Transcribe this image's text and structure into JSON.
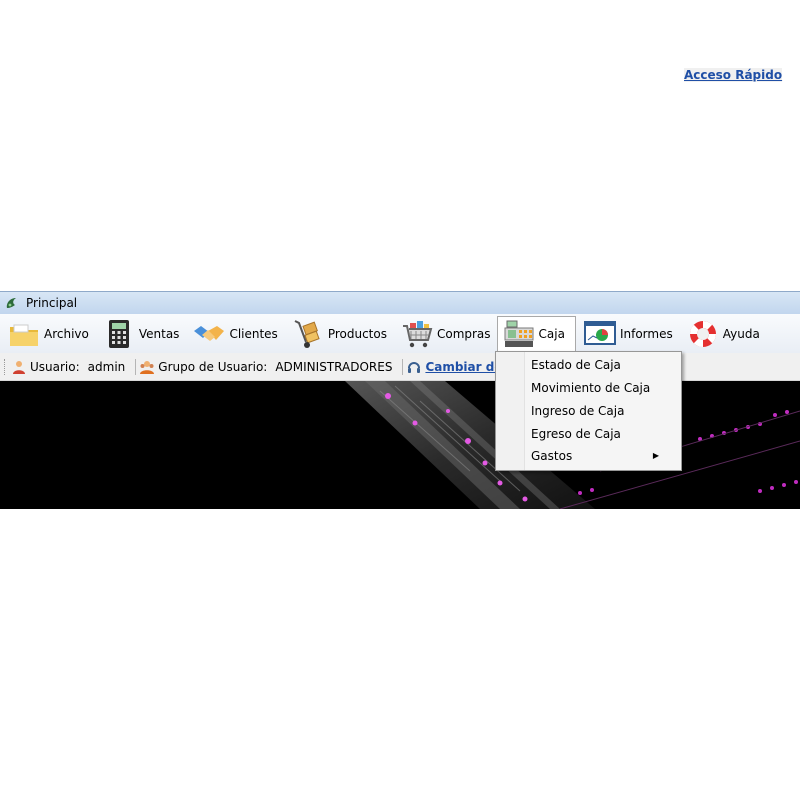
{
  "window": {
    "title": "Principal"
  },
  "menu": {
    "items": [
      {
        "label": "Archivo",
        "icon": "folder-icon"
      },
      {
        "label": "Ventas",
        "icon": "calculator-icon"
      },
      {
        "label": "Clientes",
        "icon": "handshake-icon"
      },
      {
        "label": "Productos",
        "icon": "hand-truck-icon"
      },
      {
        "label": "Compras",
        "icon": "shopping-cart-icon"
      },
      {
        "label": "Caja",
        "icon": "cash-register-icon",
        "active": true
      },
      {
        "label": "Informes",
        "icon": "report-chart-icon"
      },
      {
        "label": "Ayuda",
        "icon": "lifebuoy-icon"
      }
    ]
  },
  "status": {
    "user_label": "Usuario:",
    "user_value": "admin",
    "group_label": "Grupo de Usuario:",
    "group_value": "ADMINISTRADORES",
    "change_user": "Cambiar de Usuario",
    "quick_access": "Acceso Rápido"
  },
  "caja_menu": {
    "items": [
      {
        "label": "Estado de Caja"
      },
      {
        "label": "Movimiento de Caja"
      },
      {
        "label": "Ingreso de Caja"
      },
      {
        "label": "Egreso de Caja"
      },
      {
        "label": "Gastos",
        "submenu": true
      }
    ]
  },
  "colors": {
    "link": "#1f4fa6",
    "banner_glow": "#e040e0"
  }
}
